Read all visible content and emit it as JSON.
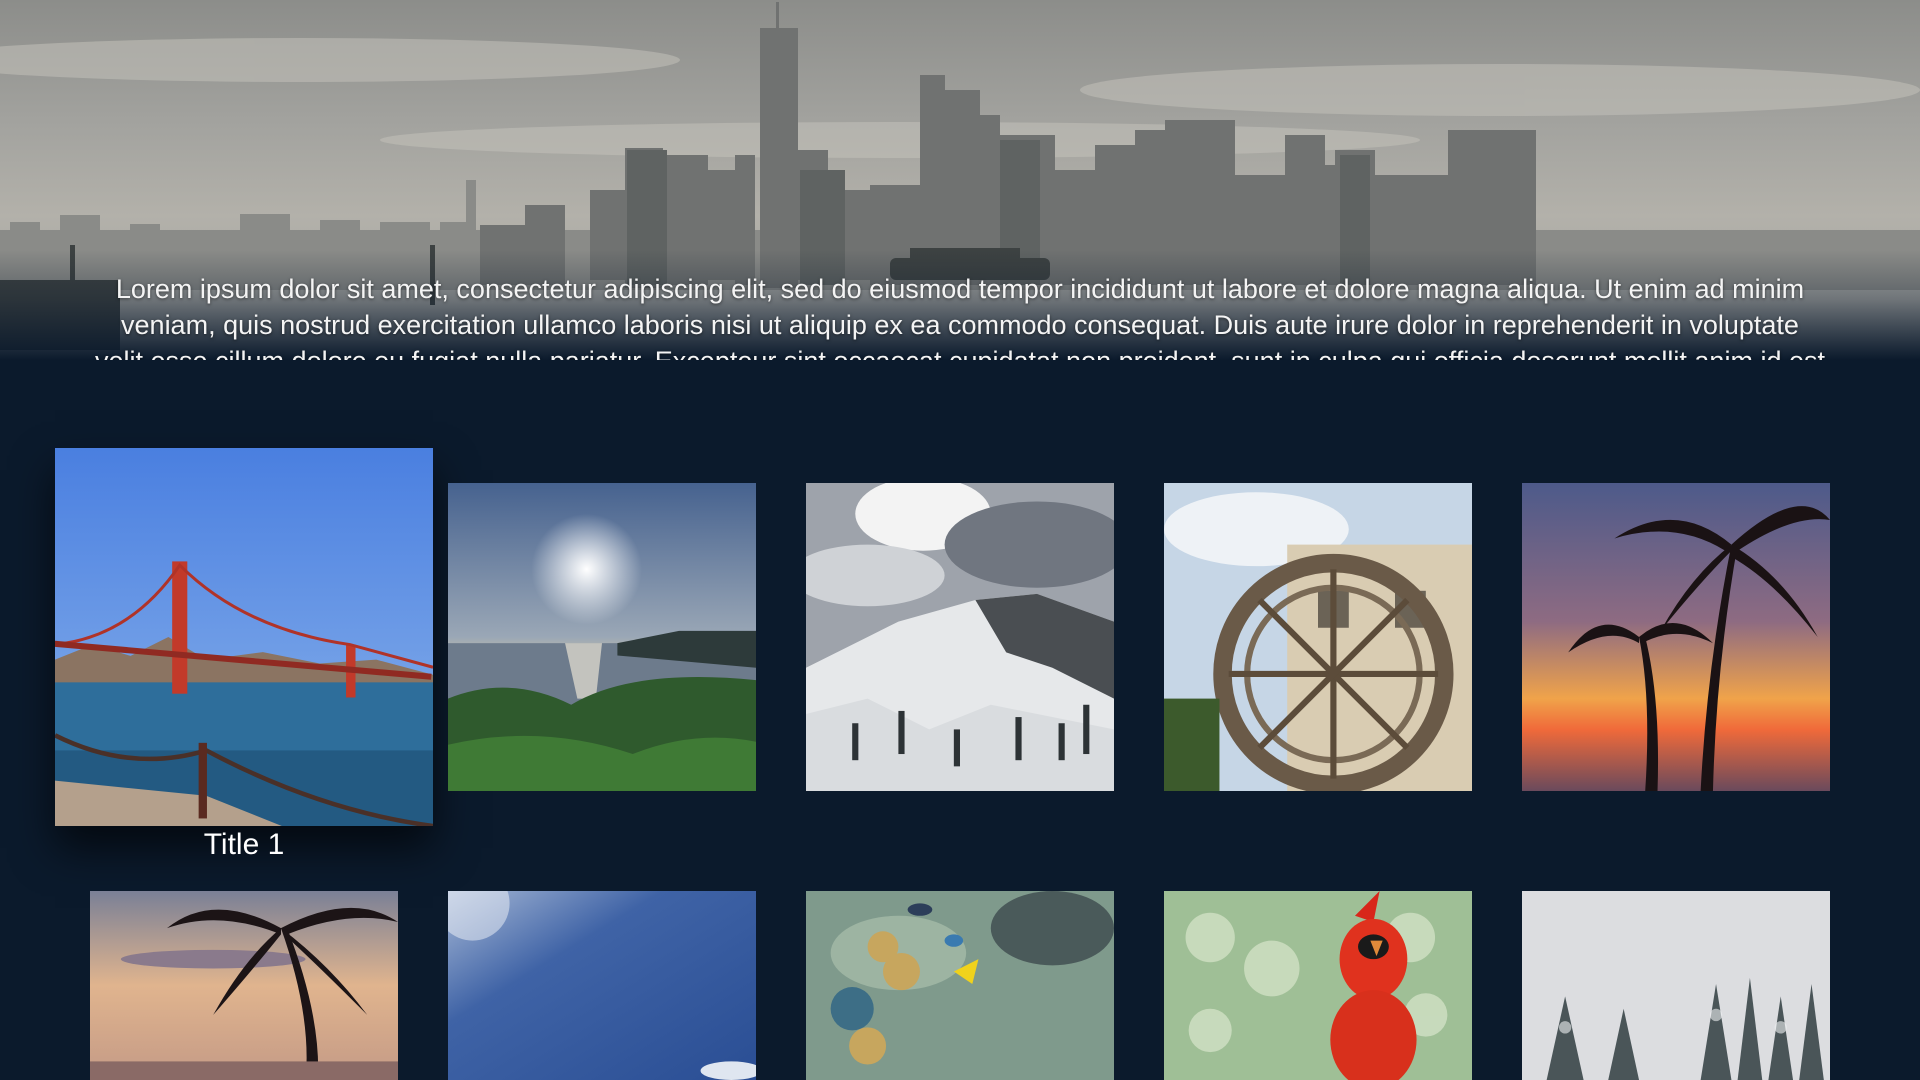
{
  "header": {
    "description": "Lorem ipsum dolor sit amet, consectetur adipiscing elit, sed do eiusmod tempor incididunt ut labore et dolore magna aliqua. Ut enim ad minim veniam, quis nostrud exercitation ullamco laboris nisi ut aliquip ex ea commodo consequat. Duis aute irure dolor in reprehenderit in voluptate velit esse cillum dolore eu fugiat nulla pariatur. Excepteur sint occaecat cupidatat non proident, sunt in culpa qui officia deserunt mollit anim id est laborum."
  },
  "grid": {
    "focused_title": "Title 1",
    "row1": [
      "golden-gate-bridge",
      "ocean-sunset-coast",
      "snowy-mountain",
      "water-wheel",
      "palm-sunset"
    ],
    "row2": [
      "palm-beach-dusk",
      "blue-sky",
      "coral-reef",
      "red-cardinal",
      "snowy-forest"
    ]
  },
  "colors": {
    "background": "#0b1a2c",
    "text": "#f4f4f4"
  }
}
